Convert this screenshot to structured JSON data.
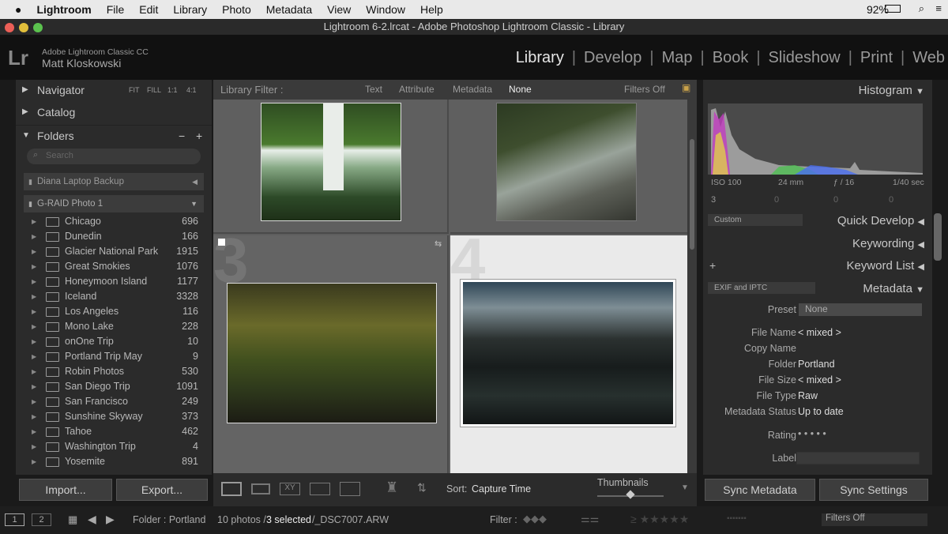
{
  "menubar": {
    "items": [
      "Lightroom",
      "File",
      "Edit",
      "Library",
      "Photo",
      "Metadata",
      "View",
      "Window",
      "Help"
    ],
    "battery": "92%"
  },
  "window": {
    "title": "Lightroom 6-2.lrcat - Adobe Photoshop Lightroom Classic - Library"
  },
  "identity": {
    "logo": "Lr",
    "product": "Adobe Lightroom Classic CC",
    "user": "Matt Kloskowski"
  },
  "modules": [
    "Library",
    "Develop",
    "Map",
    "Book",
    "Slideshow",
    "Print",
    "Web"
  ],
  "left": {
    "navigator": {
      "label": "Navigator",
      "zooms": [
        "FIT",
        "FILL",
        "1:1",
        "4:1"
      ]
    },
    "catalog": "Catalog",
    "folders": "Folders",
    "folder_minus": "−",
    "folder_plus": "+",
    "search_placeholder": "Search",
    "volumes": [
      "Diana Laptop Backup",
      "G-RAID Photo 1"
    ],
    "items": [
      {
        "name": "Chicago",
        "count": "696"
      },
      {
        "name": "Dunedin",
        "count": "166"
      },
      {
        "name": "Glacier National Park",
        "count": "1915"
      },
      {
        "name": "Great Smokies",
        "count": "1076"
      },
      {
        "name": "Honeymoon Island",
        "count": "1177"
      },
      {
        "name": "Iceland",
        "count": "3328"
      },
      {
        "name": "Los Angeles",
        "count": "116"
      },
      {
        "name": "Mono Lake",
        "count": "228"
      },
      {
        "name": "onOne Trip",
        "count": "10"
      },
      {
        "name": "Portland Trip May",
        "count": "9"
      },
      {
        "name": "Robin Photos",
        "count": "530"
      },
      {
        "name": "San Diego Trip",
        "count": "1091"
      },
      {
        "name": "San Francisco",
        "count": "249"
      },
      {
        "name": "Sunshine Skyway",
        "count": "373"
      },
      {
        "name": "Tahoe",
        "count": "462"
      },
      {
        "name": "Washington Trip",
        "count": "4"
      },
      {
        "name": "Yosemite",
        "count": "891"
      }
    ],
    "import": "Import...",
    "export": "Export..."
  },
  "filter": {
    "label": "Library Filter :",
    "options": [
      "Text",
      "Attribute",
      "Metadata",
      "None"
    ],
    "status": "Filters Off"
  },
  "grid": {
    "cell_numbers": [
      "3",
      "4"
    ]
  },
  "toolbar": {
    "sort_label": "Sort:",
    "sort_value": "Capture Time",
    "thumbs_label": "Thumbnails"
  },
  "right": {
    "histogram": "Histogram",
    "exif": [
      "ISO 100",
      "24 mm",
      "ƒ / 16",
      "1/40 sec"
    ],
    "preset_counts": [
      "3",
      "0",
      "0",
      "0"
    ],
    "quick_develop_preset": "Custom",
    "quick_develop": "Quick Develop",
    "keywording": "Keywording",
    "keyword_list": "Keyword List",
    "metadata_view": "EXIF and IPTC",
    "metadata": "Metadata",
    "preset_label": "Preset",
    "preset_value": "None",
    "fields": [
      {
        "label": "File Name",
        "value": "< mixed >"
      },
      {
        "label": "Copy Name",
        "value": ""
      },
      {
        "label": "Folder",
        "value": "Portland"
      },
      {
        "label": "File Size",
        "value": "< mixed >"
      },
      {
        "label": "File Type",
        "value": "Raw"
      },
      {
        "label": "Metadata Status",
        "value": "Up to date"
      }
    ],
    "rating_label": "Rating",
    "rating_dots": "• • • • •",
    "label_label": "Label",
    "sync_metadata": "Sync Metadata",
    "sync_settings": "Sync Settings"
  },
  "filmstrip": {
    "pages": [
      "1",
      "2"
    ],
    "source": "Folder : Portland",
    "count_text": "10 photos /",
    "selected": "3 selected",
    "file": "/_DSC7007.ARW",
    "filter_label": "Filter :",
    "stars": "≥ ★★★★★",
    "filter_status": "Filters Off"
  }
}
